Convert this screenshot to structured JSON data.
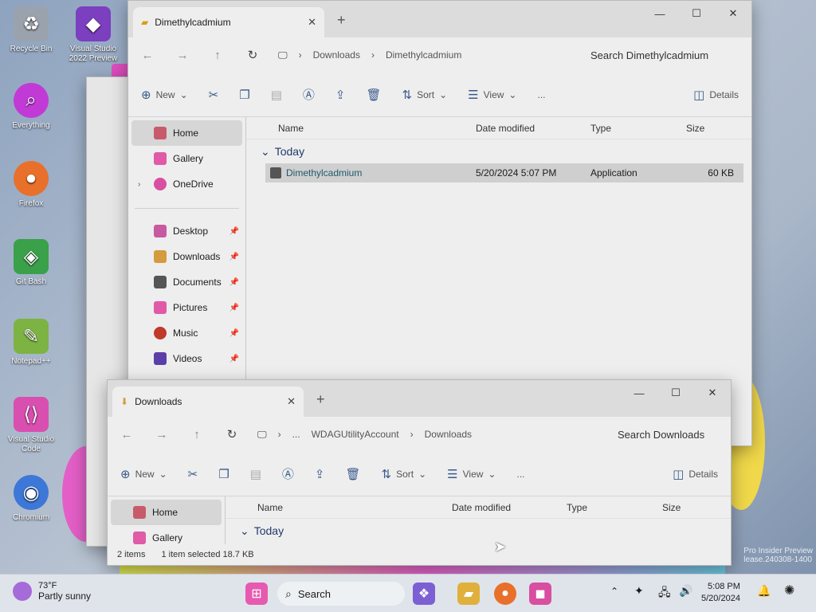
{
  "desktop": {
    "icons": [
      {
        "label": "Recycle Bin",
        "icon": "recycle-bin-icon",
        "color": "#9aa3ad"
      },
      {
        "label": "Visual Studio 2022 Preview",
        "icon": "visual-studio-preview-icon",
        "color": "#7b3fbf"
      },
      {
        "label": "Everything",
        "icon": "everything-icon",
        "color": "#c13ad6"
      },
      {
        "label": "Firefox",
        "icon": "firefox-icon",
        "color": "#e8702a"
      },
      {
        "label": "Git Bash",
        "icon": "git-bash-icon",
        "color": "#3aa04a"
      },
      {
        "label": "Notepad++",
        "icon": "notepad-plus-plus-icon",
        "color": "#7cb342"
      },
      {
        "label": "Visual Studio Code",
        "icon": "vscode-icon",
        "color": "#d94fb0"
      },
      {
        "label": "Chromium",
        "icon": "chromium-icon",
        "color": "#3d78d8"
      }
    ],
    "watermark_line1": "Pro Insider Preview",
    "watermark_line2": "lease.240308-1400"
  },
  "window1": {
    "tab_title": "Dimethylcadmium",
    "breadcrumb": [
      "Downloads",
      "Dimethylcadmium"
    ],
    "search_placeholder": "Search Dimethylcadmium",
    "commands": {
      "new": "New",
      "sort": "Sort",
      "view": "View",
      "more": "...",
      "details": "Details"
    },
    "nav_items": [
      {
        "label": "Home",
        "icon": "home-icon",
        "selected": true
      },
      {
        "label": "Gallery",
        "icon": "gallery-icon"
      },
      {
        "label": "OneDrive",
        "icon": "onedrive-icon",
        "expandable": true
      },
      {
        "label": "Desktop",
        "icon": "desktop-folder-icon",
        "pinned": true
      },
      {
        "label": "Downloads",
        "icon": "downloads-folder-icon",
        "pinned": true
      },
      {
        "label": "Documents",
        "icon": "documents-folder-icon",
        "pinned": true
      },
      {
        "label": "Pictures",
        "icon": "pictures-folder-icon",
        "pinned": true
      },
      {
        "label": "Music",
        "icon": "music-folder-icon",
        "pinned": true
      },
      {
        "label": "Videos",
        "icon": "videos-folder-icon",
        "pinned": true
      }
    ],
    "columns": {
      "name": "Name",
      "date": "Date modified",
      "type": "Type",
      "size": "Size"
    },
    "group_label": "Today",
    "files": [
      {
        "name": "Dimethylcadmium",
        "date": "5/20/2024 5:07 PM",
        "type": "Application",
        "size": "60 KB"
      }
    ]
  },
  "window2": {
    "tab_title": "Downloads",
    "breadcrumb": [
      "...",
      "WDAGUtilityAccount",
      "Downloads"
    ],
    "search_placeholder": "Search Downloads",
    "commands": {
      "new": "New",
      "sort": "Sort",
      "view": "View",
      "more": "...",
      "details": "Details"
    },
    "nav_items": [
      {
        "label": "Home",
        "icon": "home-icon",
        "selected": true
      },
      {
        "label": "Gallery",
        "icon": "gallery-icon"
      }
    ],
    "columns": {
      "name": "Name",
      "date": "Date modified",
      "type": "Type",
      "size": "Size"
    },
    "group_label": "Today",
    "status": {
      "items": "2 items",
      "selected": "1 item selected  18.7 KB"
    }
  },
  "taskbar": {
    "weather_temp": "73°F",
    "weather_desc": "Partly sunny",
    "search_label": "Search",
    "time": "5:08 PM",
    "date": "5/20/2024"
  }
}
